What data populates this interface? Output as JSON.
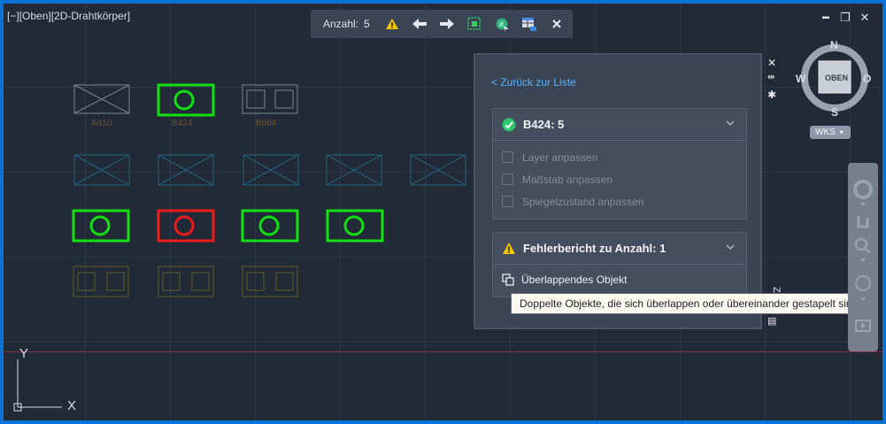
{
  "viewport": {
    "label": "[−][Oben][2D-Drahtkörper]"
  },
  "window_controls": {
    "minimize": "▬",
    "restore": "❐",
    "close": "✕"
  },
  "toolbar": {
    "count_label": "Anzahl:",
    "count_value": "5"
  },
  "drawing": {
    "labels": {
      "a410": "A410",
      "b424": "B424",
      "b684": "B684"
    }
  },
  "panel": {
    "back_link": "< Zurück zur Liste",
    "block_section": {
      "title": "B424: 5",
      "options": [
        "Layer anpassen",
        "Maßstab anpassen",
        "Spiegelzustand anpassen"
      ]
    },
    "error_section": {
      "title": "Fehlerbericht zu Anzahl: 1",
      "item": "Überlappendes Objekt"
    },
    "vertical_title": "ZAHL",
    "tooltip": "Doppelte Objekte, die sich überlappen oder übereinander gestapelt sind"
  },
  "viewcube": {
    "n": "N",
    "s": "S",
    "w": "W",
    "o": "O",
    "face": "OBEN",
    "wcs": "WKS"
  },
  "ucs": {
    "y": "Y",
    "x": "X"
  },
  "colors": {
    "accent_blue": "#0a72d6",
    "selected_green": "#13e013",
    "error_red": "#ee1b1b",
    "link": "#59b3ff"
  }
}
